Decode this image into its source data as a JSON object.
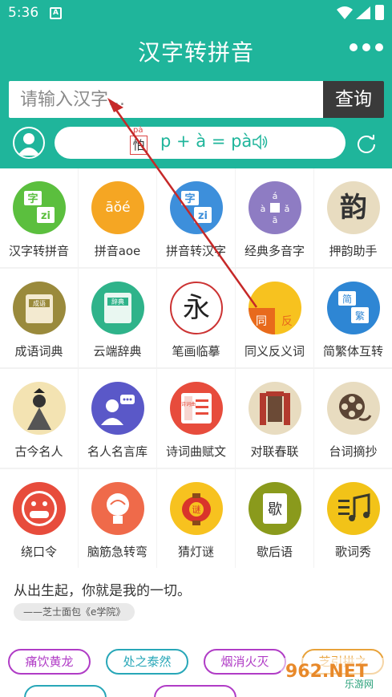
{
  "status_bar": {
    "time": "5:36",
    "notification_letter": "A"
  },
  "app_bar": {
    "title": "汉字转拼音",
    "menu_icon": "more-dots-icon"
  },
  "search": {
    "placeholder": "请输入汉字...",
    "button_label": "查询"
  },
  "pinyin_example": {
    "character": "怕",
    "character_pinyin": "pà",
    "formula": "p + à = pà"
  },
  "grid": [
    {
      "label": "汉字转拼音",
      "color": "#5bbf3e",
      "icon": "hanzi-to-pinyin-icon"
    },
    {
      "label": "拼音aoe",
      "color": "#f5a623",
      "icon": "pinyin-aoe-icon",
      "glyph": "āŏé"
    },
    {
      "label": "拼音转汉字",
      "color": "#3d8fdb",
      "icon": "pinyin-to-hanzi-icon"
    },
    {
      "label": "经典多音字",
      "color": "#8e7cc3",
      "icon": "polyphone-icon"
    },
    {
      "label": "押韵助手",
      "color": "#e8dcc0",
      "icon": "rhyme-icon",
      "glyph": "韵"
    },
    {
      "label": "成语词典",
      "color": "#9a8a3c",
      "icon": "idiom-dictionary-icon",
      "glyph": "成语"
    },
    {
      "label": "云端辞典",
      "color": "#2fb38a",
      "icon": "cloud-dictionary-icon",
      "glyph": "辞典"
    },
    {
      "label": "笔画临摹",
      "color": "#ffffff",
      "icon": "stroke-copy-icon",
      "glyph": "永"
    },
    {
      "label": "同义反义词",
      "color": "#f7c21f",
      "icon": "synonym-antonym-icon"
    },
    {
      "label": "简繁体互转",
      "color": "#2e86d4",
      "icon": "simplified-traditional-icon"
    },
    {
      "label": "古今名人",
      "color": "#f3e3b2",
      "icon": "famous-people-icon"
    },
    {
      "label": "名人名言库",
      "color": "#5a58c8",
      "icon": "quotes-icon"
    },
    {
      "label": "诗词曲赋文",
      "color": "#e74c3c",
      "icon": "poetry-icon",
      "glyph": "诗词曲"
    },
    {
      "label": "对联春联",
      "color": "#e8dcc0",
      "icon": "couplet-icon"
    },
    {
      "label": "台词摘抄",
      "color": "#e8dcc0",
      "icon": "film-reel-icon"
    },
    {
      "label": "绕口令",
      "color": "#e74c3c",
      "icon": "tongue-twister-icon"
    },
    {
      "label": "脑筋急转弯",
      "color": "#ef6a4a",
      "icon": "brain-teaser-icon"
    },
    {
      "label": "猜灯谜",
      "color": "#f7c21f",
      "icon": "lantern-riddle-icon",
      "glyph": "谜"
    },
    {
      "label": "歇后语",
      "color": "#8a9a1c",
      "icon": "xiehouyu-icon",
      "glyph": "歇"
    },
    {
      "label": "歌词秀",
      "color": "#f2c318",
      "icon": "lyrics-icon"
    }
  ],
  "quote": {
    "text": "从出生起，你就是我的一切。",
    "source": "——芝士面包《e学院》"
  },
  "tags": [
    {
      "label": "痛饮黄龙",
      "color": "#b03cc6"
    },
    {
      "label": "处之泰然",
      "color": "#28a7b8"
    },
    {
      "label": "烟消火灭",
      "color": "#b03cc6"
    },
    {
      "label": "芝引拱之",
      "color": "#e8a23a"
    }
  ],
  "watermark": {
    "text": "962.NET",
    "subtext": "乐游网"
  }
}
